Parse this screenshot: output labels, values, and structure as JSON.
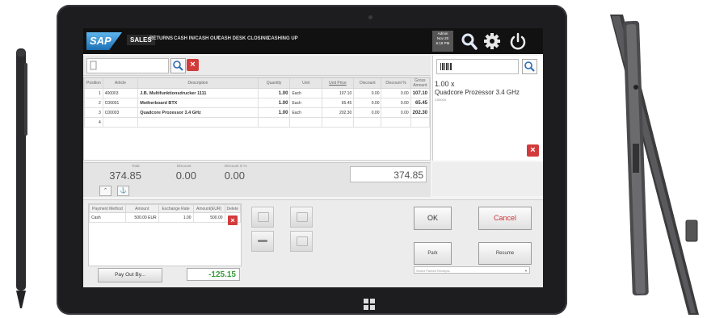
{
  "app": {
    "logo": "SAP",
    "nav": [
      "SALES",
      "RETURNS",
      "CASH IN/CASH OUT",
      "CASH DESK CLOSING",
      "CASHING UP"
    ],
    "user": [
      "Admin",
      "Nov 20",
      "6:18 PM"
    ],
    "icons": [
      "search-icon",
      "gear-icon",
      "power-icon"
    ]
  },
  "items_table": {
    "columns": [
      "Position",
      "Article",
      "Description",
      "Quantity",
      "Unit",
      "Unit Price",
      "Discount",
      "Discount %",
      "Gross Amount"
    ],
    "rows": [
      {
        "pos": "1",
        "article": "400003",
        "desc": "J.B. Multifunktionsdrucker 1111",
        "qty": "1.00",
        "unit": "Each",
        "price": "107.10",
        "disc": "0.00",
        "discp": "0.00",
        "gross": "107.10"
      },
      {
        "pos": "2",
        "article": "C00001",
        "desc": "Motherboard BTX",
        "qty": "1.00",
        "unit": "Each",
        "price": "65.45",
        "disc": "0.00",
        "discp": "0.00",
        "gross": "65.45"
      },
      {
        "pos": "3",
        "article": "C00003",
        "desc": "Quadcore Prozessor 3.4 GHz",
        "qty": "1.00",
        "unit": "Each",
        "price": "202.30",
        "disc": "0.00",
        "discp": "0.00",
        "gross": "202.30"
      },
      {
        "pos": "4",
        "article": "",
        "desc": "",
        "qty": "",
        "unit": "",
        "price": "",
        "disc": "",
        "discp": "",
        "gross": ""
      }
    ]
  },
  "detail": {
    "qty": "1.00 x",
    "name": "Quadcore Prozessor 3.4 GHz",
    "code": "C00003"
  },
  "totals": {
    "total_label": "Total",
    "total": "374.85",
    "discount_label": "Discount",
    "discount": "0.00",
    "discount_pct_label": "Discount in %",
    "discount_pct": "0.00",
    "gross_total": "374.85"
  },
  "payments": {
    "columns": [
      "Payment Method",
      "Amount",
      "Exchange Rate",
      "Amount(EUR)",
      "Delete"
    ],
    "rows": [
      {
        "method": "Cash",
        "amount": "500.00 EUR",
        "rate": "1.00",
        "amount_eur": "500.00"
      }
    ],
    "payout_label": "Pay Out By...",
    "change": "-125.15"
  },
  "actions": {
    "ok": "OK",
    "cancel": "Cancel",
    "park": "Park",
    "resume": "Resume",
    "parked_placeholder": "Select Parked Receipts"
  },
  "colors": {
    "accent_red": "#d23b3b",
    "change_green": "#3a9a3a",
    "topbar": "#111111"
  }
}
